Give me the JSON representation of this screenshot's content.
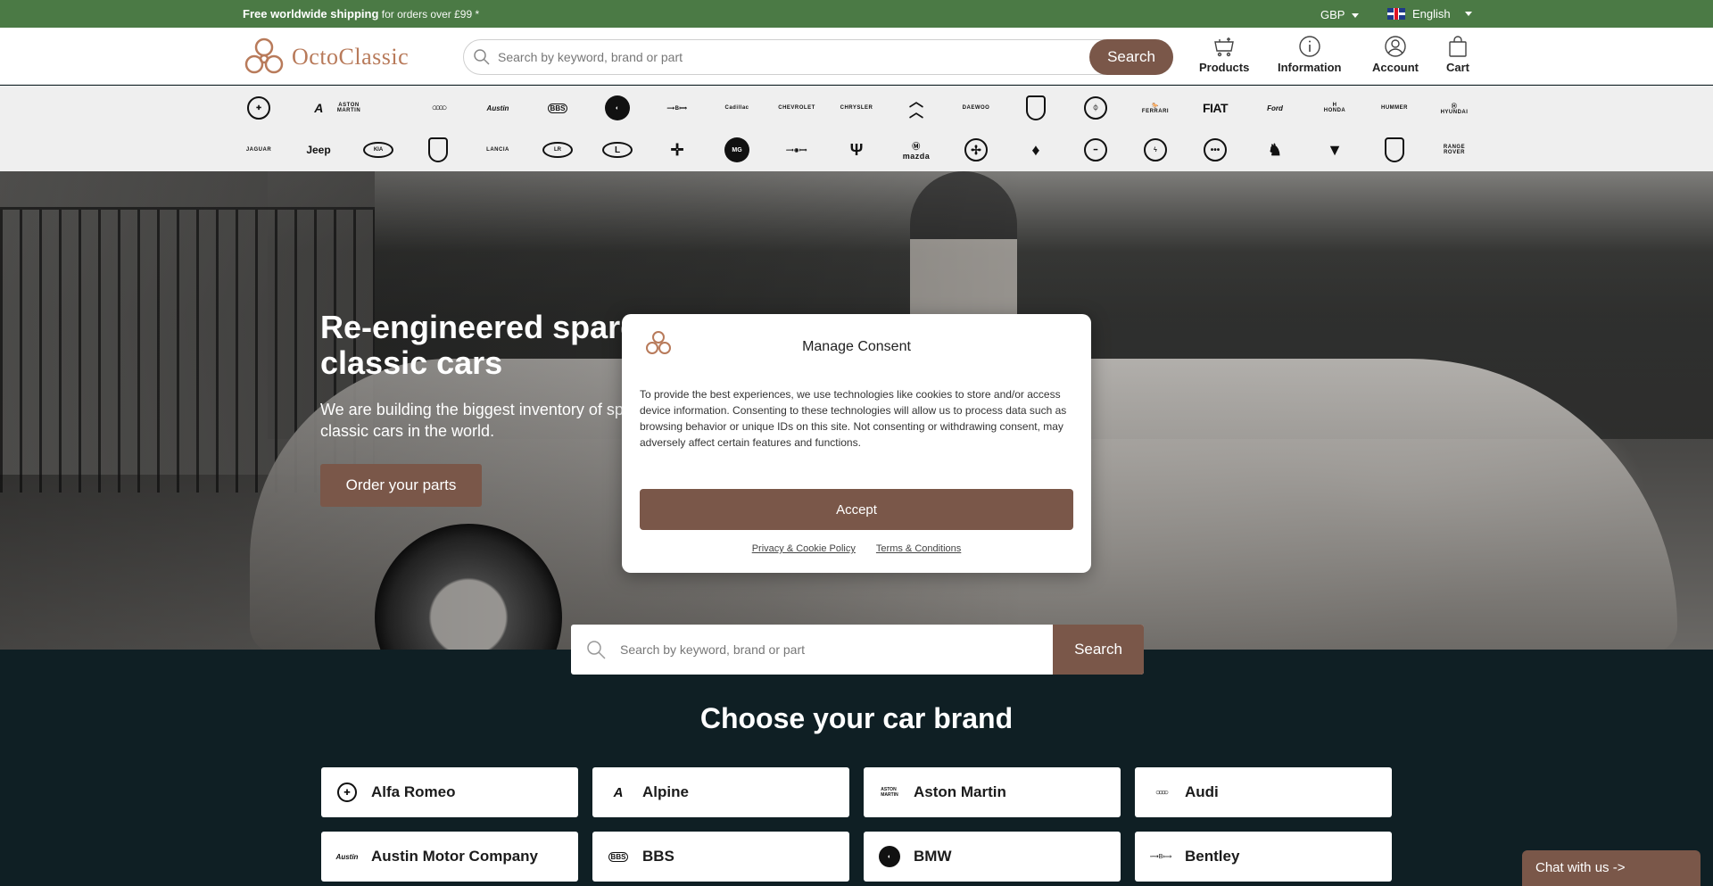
{
  "topbar": {
    "shipping_bold": "Free worldwide shipping",
    "shipping_rest": " for orders over £99 *",
    "currency": "GBP",
    "language": "English"
  },
  "header": {
    "brand": "OctoClassic",
    "search_placeholder": "Search by keyword, brand or part",
    "search_button": "Search",
    "nav": {
      "products": "Products",
      "information": "Information",
      "account": "Account",
      "cart": "Cart"
    }
  },
  "brand_strip": {
    "row1": [
      "alfa-romeo",
      "alpine",
      "aston-martin",
      "audi",
      "austin",
      "bbs",
      "bmw",
      "bentley",
      "cadillac",
      "chevrolet",
      "chrysler",
      "citroen",
      "daewoo",
      "dodge",
      "ferrari-circle",
      "ferrari",
      "fiat",
      "ford",
      "honda",
      "hummer",
      "hyundai"
    ],
    "row2": [
      "jaguar",
      "jeep",
      "kia",
      "lamborghini",
      "lancia",
      "land-rover",
      "lexus",
      "lincoln",
      "mg",
      "mini",
      "maserati",
      "mazda",
      "mercedes",
      "mitsubishi",
      "nissan",
      "opel",
      "other",
      "peugeot",
      "pontiac",
      "porsche",
      "range-rover"
    ],
    "labels": {
      "fiat": "FIAT",
      "jeep": "Jeep",
      "kia": "KIA",
      "lancia": "LANCIA",
      "ford": "Ford",
      "mazda": "mazda",
      "range-rover": "RANGE ROVER"
    }
  },
  "hero": {
    "title": "Re-engineered spare parts for classic cars",
    "subtitle": "We are building the biggest inventory of spare part models for classic cars in the world.",
    "cta": "Order your parts"
  },
  "big_search": {
    "placeholder": "Search by keyword, brand or part",
    "button": "Search"
  },
  "brands_section": {
    "title": "Choose your car brand",
    "brands": [
      {
        "name": "Alfa Romeo",
        "icon": "alfa-romeo-icon"
      },
      {
        "name": "Alpine",
        "icon": "alpine-icon"
      },
      {
        "name": "Aston Martin",
        "icon": "aston-martin-icon"
      },
      {
        "name": "Audi",
        "icon": "audi-icon"
      },
      {
        "name": "Austin Motor Company",
        "icon": "austin-icon"
      },
      {
        "name": "BBS",
        "icon": "bbs-icon"
      },
      {
        "name": "BMW",
        "icon": "bmw-icon"
      },
      {
        "name": "Bentley",
        "icon": "bentley-icon"
      }
    ]
  },
  "consent": {
    "title": "Manage Consent",
    "body": "To provide the best experiences, we use technologies like cookies to store and/or access device information. Consenting to these technologies will allow us to process data such as browsing behavior or unique IDs on this site. Not consenting or withdrawing consent, may adversely affect certain features and functions.",
    "accept": "Accept",
    "privacy_link": "Privacy & Cookie Policy",
    "terms_link": "Terms & Conditions"
  },
  "chat": {
    "label": "Chat with us ->"
  },
  "colors": {
    "topbar": "#4b7a45",
    "accent": "#7a5749",
    "logo": "#b87a5a",
    "section_bg": "#0f1f24"
  }
}
